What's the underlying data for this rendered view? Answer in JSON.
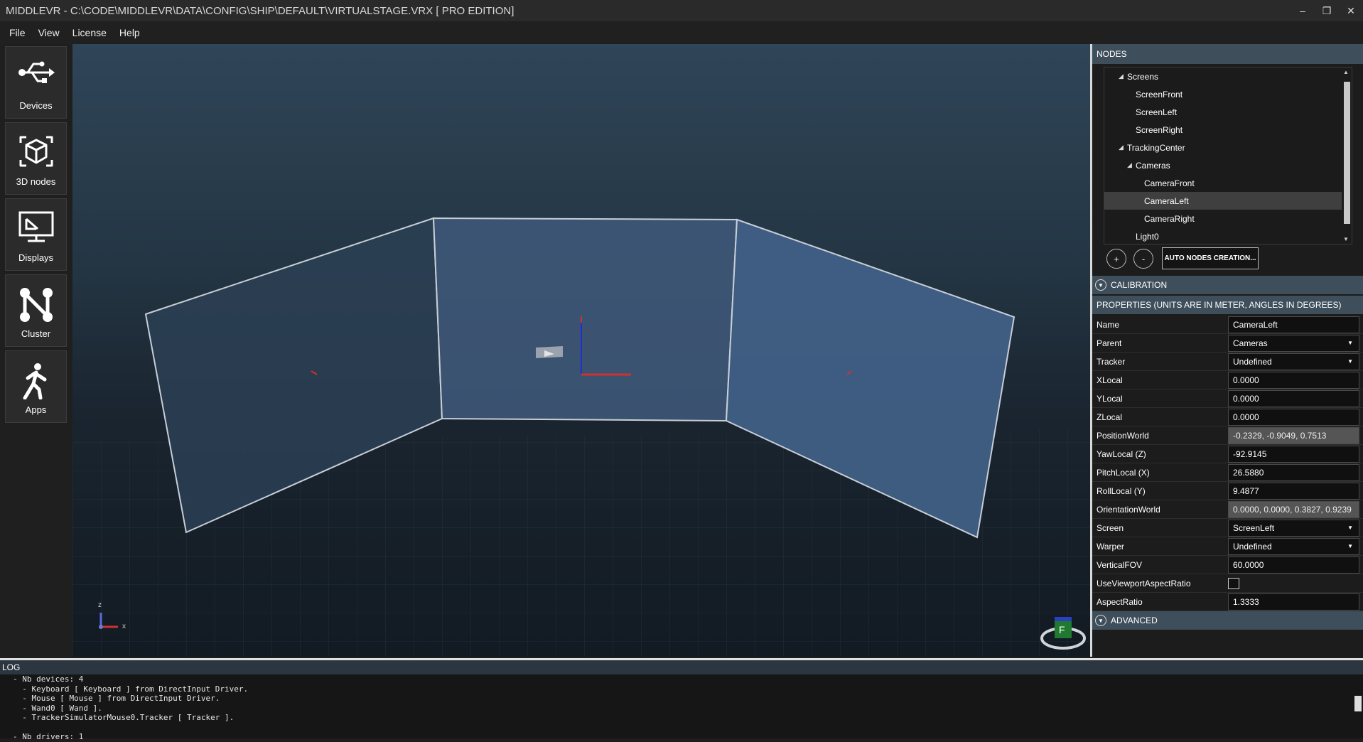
{
  "window": {
    "title": "MIDDLEVR - C:\\CODE\\MIDDLEVR\\DATA\\CONFIG\\SHIP\\DEFAULT\\VIRTUALSTAGE.VRX [ PRO EDITION]",
    "minimize": "–",
    "restore": "❐",
    "close": "✕"
  },
  "menu": [
    "File",
    "View",
    "License",
    "Help"
  ],
  "sidebar": [
    {
      "label": "Devices",
      "icon": "usb-icon"
    },
    {
      "label": "3D nodes",
      "icon": "cube-icon"
    },
    {
      "label": "Displays",
      "icon": "display-icon"
    },
    {
      "label": "Cluster",
      "icon": "cluster-icon"
    },
    {
      "label": "Apps",
      "icon": "walking-person-icon"
    }
  ],
  "viewport": {
    "axis_z": "z",
    "axis_x": "x",
    "gizmo_label": "F"
  },
  "nodes": {
    "header": "NODES",
    "tree": [
      {
        "label": "Screens",
        "level": 0,
        "expanded": true
      },
      {
        "label": "ScreenFront",
        "level": 1
      },
      {
        "label": "ScreenLeft",
        "level": 1
      },
      {
        "label": "ScreenRight",
        "level": 1
      },
      {
        "label": "TrackingCenter",
        "level": 0,
        "expanded": true
      },
      {
        "label": "Cameras",
        "level": 1,
        "expanded": true
      },
      {
        "label": "CameraFront",
        "level": 2
      },
      {
        "label": "CameraLeft",
        "level": 2,
        "selected": true
      },
      {
        "label": "CameraRight",
        "level": 2
      },
      {
        "label": "Light0",
        "level": 1
      }
    ],
    "add_label": "+",
    "remove_label": "-",
    "auto_label": "AUTO NODES CREATION..."
  },
  "calibration": {
    "label": "CALIBRATION"
  },
  "properties": {
    "header": "PROPERTIES (UNITS ARE IN METER, ANGLES IN DEGREES)",
    "rows": [
      {
        "label": "Name",
        "value": "CameraLeft",
        "kind": "text"
      },
      {
        "label": "Parent",
        "value": "Cameras",
        "kind": "dropdown"
      },
      {
        "label": "Tracker",
        "value": "Undefined",
        "kind": "dropdown"
      },
      {
        "label": "XLocal",
        "value": "0.0000",
        "kind": "text"
      },
      {
        "label": "YLocal",
        "value": "0.0000",
        "kind": "text"
      },
      {
        "label": "ZLocal",
        "value": "0.0000",
        "kind": "text"
      },
      {
        "label": "PositionWorld",
        "value": "-0.2329, -0.9049, 0.7513",
        "kind": "readonly"
      },
      {
        "label": "YawLocal (Z)",
        "value": "-92.9145",
        "kind": "text"
      },
      {
        "label": "PitchLocal (X)",
        "value": "26.5880",
        "kind": "text"
      },
      {
        "label": "RollLocal (Y)",
        "value": "9.4877",
        "kind": "text"
      },
      {
        "label": "OrientationWorld",
        "value": "0.0000, 0.0000, 0.3827, 0.9239",
        "kind": "readonly"
      },
      {
        "label": "Screen",
        "value": "ScreenLeft",
        "kind": "dropdown"
      },
      {
        "label": "Warper",
        "value": "Undefined",
        "kind": "dropdown"
      },
      {
        "label": "VerticalFOV",
        "value": "60.0000",
        "kind": "text"
      },
      {
        "label": "UseViewportAspectRatio",
        "value": "",
        "kind": "checkbox"
      },
      {
        "label": "AspectRatio",
        "value": "1.3333",
        "kind": "text"
      }
    ]
  },
  "advanced": {
    "label": "ADVANCED"
  },
  "log": {
    "header": "LOG",
    "lines": [
      "- Nb devices: 4",
      "  - Keyboard [ Keyboard ] from DirectInput Driver.",
      "  - Mouse [ Mouse ] from DirectInput Driver.",
      "  - Wand0 [ Wand ].",
      "  - TrackerSimulatorMouse0.Tracker [ Tracker ].",
      "",
      "- Nb drivers: 1"
    ]
  }
}
